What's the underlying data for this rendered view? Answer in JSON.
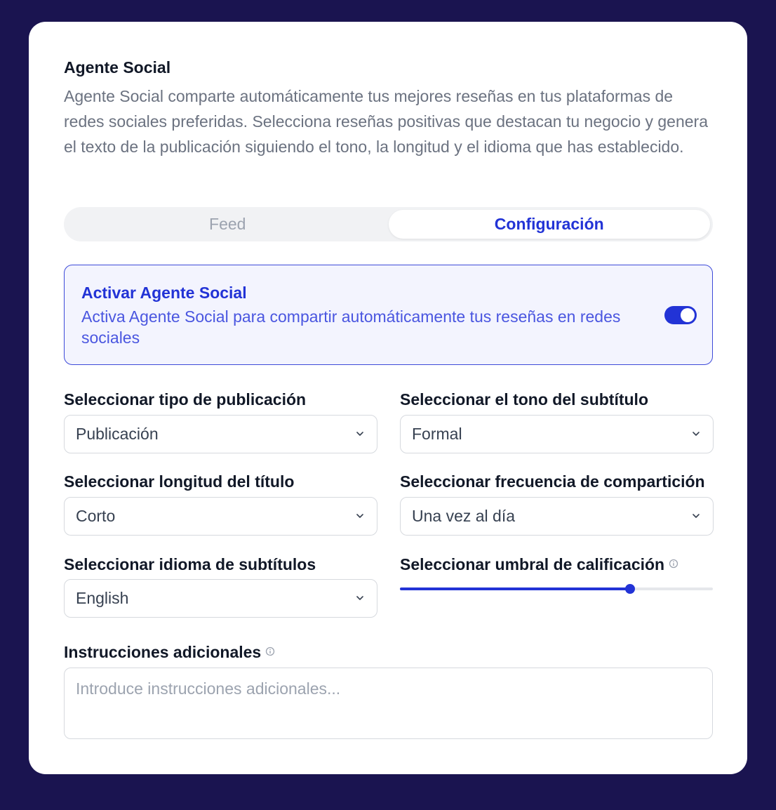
{
  "header": {
    "title": "Agente Social",
    "description": "Agente Social comparte automáticamente tus mejores reseñas en tus plataformas de redes sociales preferidas. Selecciona reseñas positivas que destacan tu negocio y genera el texto de la publicación siguiendo el tono, la longitud y el idioma que has establecido."
  },
  "tabs": [
    {
      "label": "Feed",
      "active": false
    },
    {
      "label": "Configuración",
      "active": true
    }
  ],
  "activate": {
    "title": "Activar Agente Social",
    "description": "Activa Agente Social para compartir automáticamente tus reseñas en redes sociales",
    "enabled": true
  },
  "fields": {
    "post_type": {
      "label": "Seleccionar tipo de publicación",
      "value": "Publicación"
    },
    "caption_tone": {
      "label": "Seleccionar el tono del subtítulo",
      "value": "Formal"
    },
    "title_length": {
      "label": "Seleccionar longitud del título",
      "value": "Corto"
    },
    "share_frequency": {
      "label": "Seleccionar frecuencia de compartición",
      "value": "Una vez al día"
    },
    "caption_language": {
      "label": "Seleccionar idioma de subtítulos",
      "value": "English"
    },
    "rating_threshold": {
      "label": "Seleccionar umbral de calificación",
      "fraction": 0.735
    },
    "additional_instructions": {
      "label": "Instrucciones adicionales",
      "placeholder": "Introduce instrucciones adicionales..."
    }
  },
  "colors": {
    "accent": "#2233d6",
    "background": "#1a1450"
  },
  "icons": [
    "chevron-down-icon",
    "info-icon"
  ]
}
